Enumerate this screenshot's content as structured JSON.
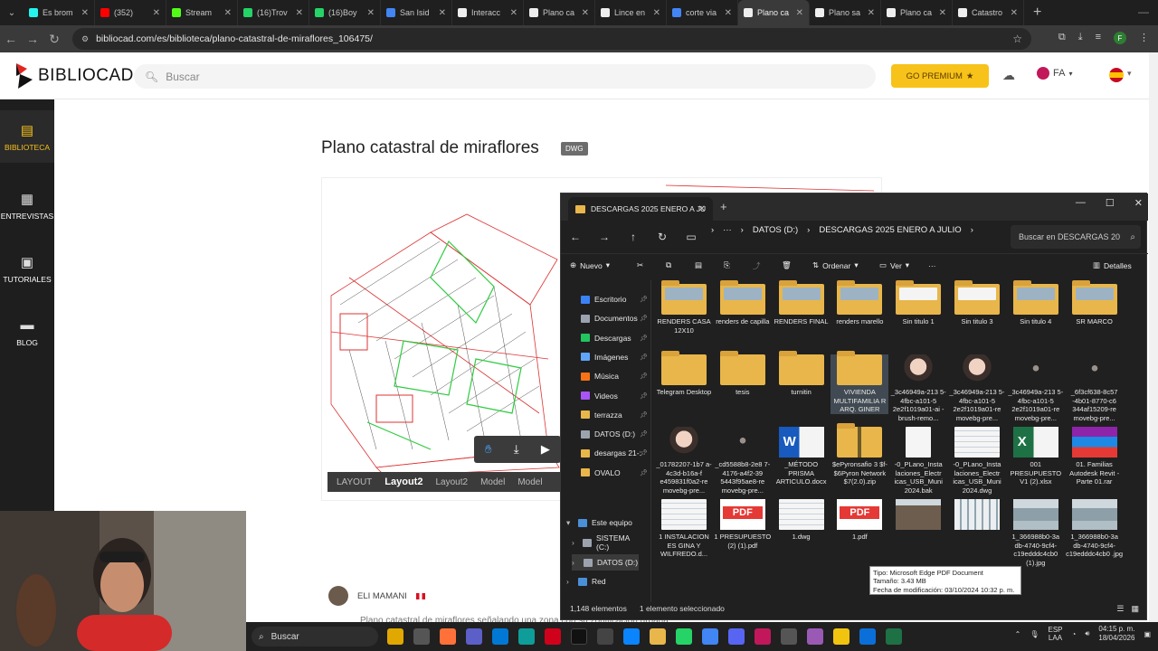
{
  "browser": {
    "tabs": [
      {
        "label": "Es brom",
        "color": "#25f4ee"
      },
      {
        "label": "(352)",
        "color": "#ff0000"
      },
      {
        "label": "Stream",
        "color": "#53fc18"
      },
      {
        "label": "(16)Trov",
        "color": "#25d366"
      },
      {
        "label": "(16)Boy",
        "color": "#25d366"
      },
      {
        "label": "San Isid",
        "color": "#4285f4"
      },
      {
        "label": "Interacc",
        "color": "#eeeeee"
      },
      {
        "label": "Plano ca",
        "color": "#eeeeee"
      },
      {
        "label": "Lince en",
        "color": "#eeeeee"
      },
      {
        "label": "corte via",
        "color": "#4285f4"
      },
      {
        "label": "Plano ca",
        "color": "#eeeeee",
        "active": true
      },
      {
        "label": "Plano sa",
        "color": "#eeeeee"
      },
      {
        "label": "Plano ca",
        "color": "#eeeeee"
      },
      {
        "label": "Catastro",
        "color": "#eeeeee"
      }
    ],
    "url": "bibliocad.com/es/biblioteca/plano-catastral-de-miraflores_106475/",
    "profile_initial": "F"
  },
  "site": {
    "logo": "BIBLIOCAD",
    "search_placeholder": "Buscar",
    "premium_label": "GO PREMIUM",
    "lang_code": "FA",
    "sidebar": [
      {
        "label": "BIBLIOTECA",
        "icon": "library-icon",
        "active": true
      },
      {
        "label": "ENTREVISTAS",
        "icon": "interview-icon"
      },
      {
        "label": "TUTORIALES",
        "icon": "tutorial-icon"
      },
      {
        "label": "BLOG",
        "icon": "blog-icon"
      }
    ],
    "page_title": "Plano catastral de miraflores",
    "badge": "DWG",
    "viewer_tabs": [
      "LAYOUT",
      "Layout2",
      "Layout2",
      "Model",
      "Model"
    ],
    "author": "ELI MAMANI",
    "description_partial": "Plano catastral de miraflores señalando una zona con su zonificación urbana"
  },
  "explorer": {
    "tab_title": "DESCARGAS 2025 ENERO A JU",
    "breadcrumb": [
      "DATOS (D:)",
      "DESCARGAS 2025 ENERO A JULIO"
    ],
    "search_placeholder": "Buscar en DESCARGAS 20",
    "commands": {
      "new": "Nuevo",
      "sort": "Ordenar",
      "view": "Ver",
      "details": "Detalles"
    },
    "nav_pane": [
      {
        "label": "Escritorio",
        "color": "#3b82f6"
      },
      {
        "label": "Documentos",
        "color": "#9ca3af"
      },
      {
        "label": "Descargas",
        "color": "#22c55e"
      },
      {
        "label": "Imágenes",
        "color": "#60a5fa"
      },
      {
        "label": "Música",
        "color": "#f97316"
      },
      {
        "label": "Videos",
        "color": "#a855f7"
      },
      {
        "label": "terrazza",
        "color": "#e8b64a"
      },
      {
        "label": "DATOS (D:)",
        "color": "#9ca3af"
      },
      {
        "label": "desargas 21-:",
        "color": "#e8b64a"
      },
      {
        "label": "OVALO",
        "color": "#e8b64a"
      }
    ],
    "tree": [
      {
        "label": "Este equipo",
        "caret": "v"
      },
      {
        "label": "SISTEMA (C:)",
        "caret": ">"
      },
      {
        "label": "DATOS (D:)",
        "caret": ">"
      },
      {
        "label": "Red",
        "caret": ">"
      }
    ],
    "files": [
      {
        "name": "RENDERS CASA 12X10",
        "kind": "folderimg"
      },
      {
        "name": "renders de capilla",
        "kind": "folderimg"
      },
      {
        "name": "RENDERS FINAL",
        "kind": "folderimg"
      },
      {
        "name": "renders marello",
        "kind": "folderimg"
      },
      {
        "name": "Sin titulo 1",
        "kind": "folderdoc"
      },
      {
        "name": "Sin titulo 3",
        "kind": "folderdoc"
      },
      {
        "name": "Sin titulo 4",
        "kind": "folderimg"
      },
      {
        "name": "SR MARCO",
        "kind": "folderimg"
      },
      {
        "name": "Telegram Desktop",
        "kind": "folder"
      },
      {
        "name": "tesis",
        "kind": "folder"
      },
      {
        "name": "turnitin",
        "kind": "folder"
      },
      {
        "name": "VIVIENDA MULTIFAMILIA R ARQ. GINER",
        "kind": "folder",
        "selected": true
      },
      {
        "name": "_3c46949a-213 5-4fbc-a101-5 2e2f1019a01-ai -brush-remo...",
        "kind": "anime"
      },
      {
        "name": "_3c46949a-213 5-4fbc-a101-5 2e2f1019a01-re movebg-pre...",
        "kind": "anime"
      },
      {
        "name": "_3c46949a-213 5-4fbc-a101-5 2e2f1019a01-re movebg-pre...",
        "kind": "dot"
      },
      {
        "name": "_6f3cf638-8c57 -4b01-8770-c6 344af15209-re movebg-pre...",
        "kind": "dot"
      },
      {
        "name": "_01782207-1b7 a-4c3d-b16a-f e459831f0a2-re movebg-pre...",
        "kind": "anime1"
      },
      {
        "name": "_cd5588b8-2e8 7-4176-a4f2-39 5443f95ae8-re movebg-pre...",
        "kind": "dot"
      },
      {
        "name": "_MÉTODO PRISMA ARTICULO.docx",
        "kind": "word"
      },
      {
        "name": "$ePyronsafio 3 $f- $6Pyron Network $7(2.0).zip",
        "kind": "zip"
      },
      {
        "name": "-0_PLano_Insta laciones_Electr icas_USB_Muni 2024.bak",
        "kind": "blank"
      },
      {
        "name": "-0_PLano_Insta laciones_Electr icas_USB_Muni 2024.dwg",
        "kind": "plan"
      },
      {
        "name": "001 PRESUPUESTO V1 (2).xlsx",
        "kind": "excel"
      },
      {
        "name": "01. Familias Autodesk Revit - Parte 01.rar",
        "kind": "rar"
      },
      {
        "name": "1 INSTALACION ES GINA Y WILFREDO.d...",
        "kind": "plan"
      },
      {
        "name": "1 PRESUPUESTO (2) (1).pdf",
        "kind": "pdf"
      },
      {
        "name": "1.dwg",
        "kind": "plan"
      },
      {
        "name": "1.pdf",
        "kind": "pdf"
      },
      {
        "name": "",
        "kind": "building"
      },
      {
        "name": "",
        "kind": "building2"
      },
      {
        "name": "1_366988b0-3a db-4740-9cf4- c19edddc4cb0 (1).jpg",
        "kind": "photo"
      },
      {
        "name": "1_366988b0-3a db-4740-9cf4- c19edddc4cb0 .jpg",
        "kind": "photo"
      }
    ],
    "status_count": "1,148 elementos",
    "status_selected": "1 elemento seleccionado",
    "tooltip": {
      "type": "Tipo: Microsoft Edge PDF Document",
      "size": "Tamaño: 3.43 MB",
      "modified": "Fecha de modificación: 03/10/2024 10:32 p. m."
    }
  },
  "taskbar": {
    "search_placeholder": "Buscar",
    "lang_top": "ESP",
    "lang_bottom": "LAA",
    "time": "04:15 p. m.",
    "date": "18/04/2026"
  }
}
